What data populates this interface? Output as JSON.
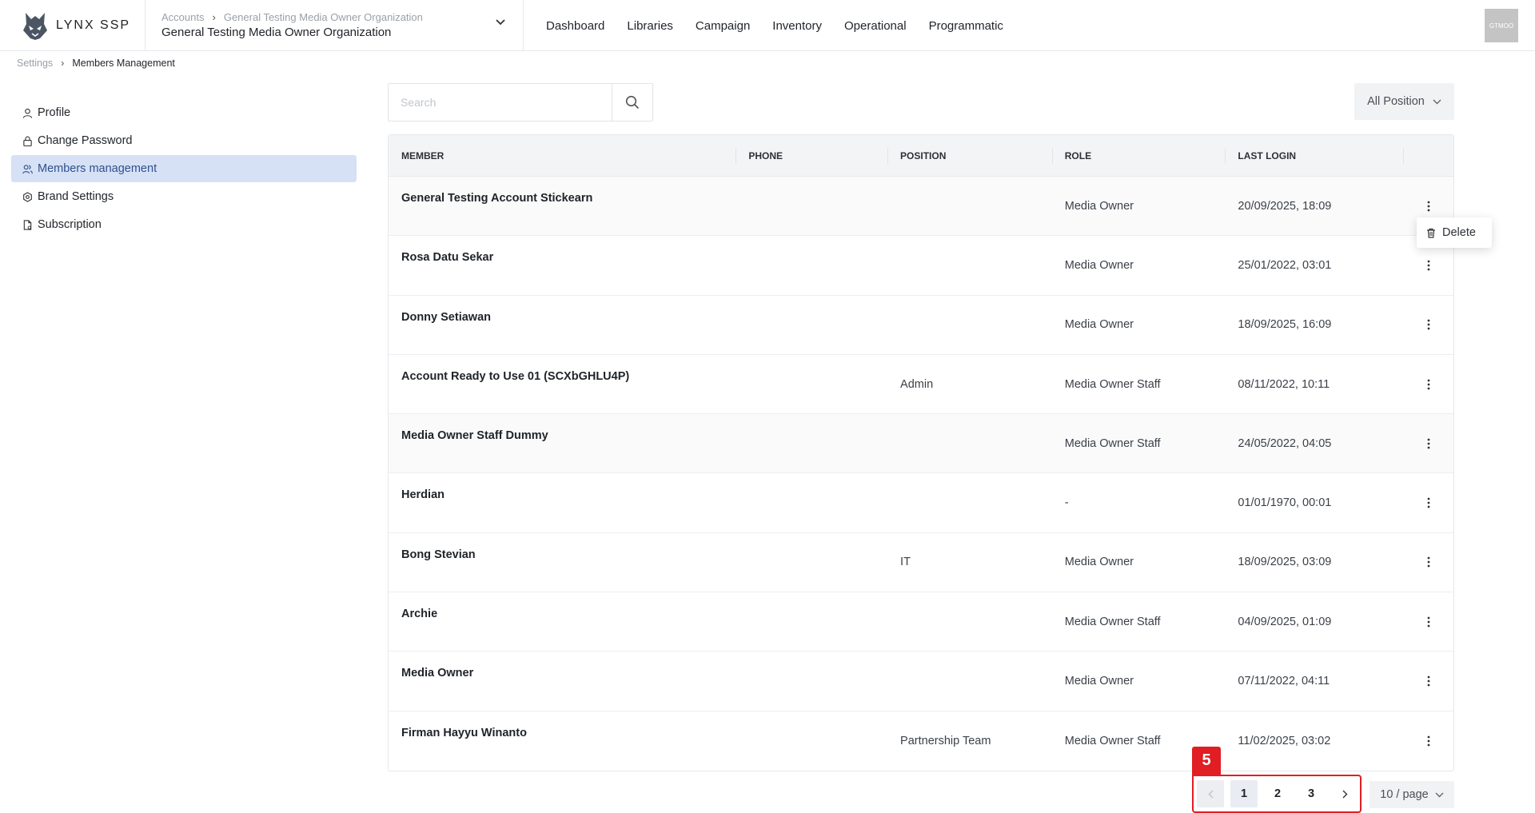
{
  "app": {
    "name": "LYNX SSP",
    "avatar_label": "GTMOO"
  },
  "org": {
    "crumb_root": "Accounts",
    "crumb_current": "General Testing Media Owner Organization",
    "title": "General Testing Media Owner Organization"
  },
  "nav": [
    "Dashboard",
    "Libraries",
    "Campaign",
    "Inventory",
    "Operational",
    "Programmatic"
  ],
  "breadcrumb": {
    "root": "Settings",
    "current": "Members Management"
  },
  "sidebar": [
    {
      "label": "Profile",
      "icon": "user-icon"
    },
    {
      "label": "Change Password",
      "icon": "lock-icon"
    },
    {
      "label": "Members management",
      "icon": "users-icon",
      "active": true
    },
    {
      "label": "Brand Settings",
      "icon": "settings-icon"
    },
    {
      "label": "Subscription",
      "icon": "document-icon"
    }
  ],
  "search": {
    "placeholder": "Search",
    "value": ""
  },
  "filter": {
    "position_label": "All Position"
  },
  "table": {
    "headers": [
      "MEMBER",
      "PHONE",
      "POSITION",
      "ROLE",
      "LAST LOGIN"
    ],
    "rows": [
      {
        "member": "General Testing Account Stickearn",
        "phone": "",
        "position": "",
        "role": "Media Owner",
        "last_login": "20/09/2025, 18:09"
      },
      {
        "member": "Rosa Datu Sekar",
        "phone": "",
        "position": "",
        "role": "Media Owner",
        "last_login": "25/01/2022, 03:01"
      },
      {
        "member": "Donny Setiawan",
        "phone": "",
        "position": "",
        "role": "Media Owner",
        "last_login": "18/09/2025, 16:09"
      },
      {
        "member": "Account Ready to Use 01 (SCXbGHLU4P)",
        "phone": "",
        "position": "Admin",
        "role": "Media Owner Staff",
        "last_login": "08/11/2022, 10:11"
      },
      {
        "member": "Media Owner Staff Dummy",
        "phone": "",
        "position": "",
        "role": "Media Owner Staff",
        "last_login": "24/05/2022, 04:05"
      },
      {
        "member": "Herdian",
        "phone": "",
        "position": "",
        "role": "-",
        "last_login": "01/01/1970, 00:01"
      },
      {
        "member": "Bong Stevian",
        "phone": "",
        "position": "IT",
        "role": "Media Owner",
        "last_login": "18/09/2025, 03:09"
      },
      {
        "member": "Archie",
        "phone": "",
        "position": "",
        "role": "Media Owner Staff",
        "last_login": "04/09/2025, 01:09"
      },
      {
        "member": "Media Owner",
        "phone": "",
        "position": "",
        "role": "Media Owner",
        "last_login": "07/11/2022, 04:11"
      },
      {
        "member": "Firman Hayyu Winanto",
        "phone": "",
        "position": "Partnership Team",
        "role": "Media Owner Staff",
        "last_login": "11/02/2025, 03:02"
      }
    ]
  },
  "row_menu": {
    "delete_label": "Delete"
  },
  "pagination": {
    "step_marker": "5",
    "pages": [
      "1",
      "2",
      "3"
    ],
    "current": "1",
    "per_page": "10 / page"
  },
  "colors": {
    "accent_red": "#e01e23",
    "active_sidebar_bg": "#d6e1f5",
    "active_sidebar_text": "#2f4f8f"
  }
}
